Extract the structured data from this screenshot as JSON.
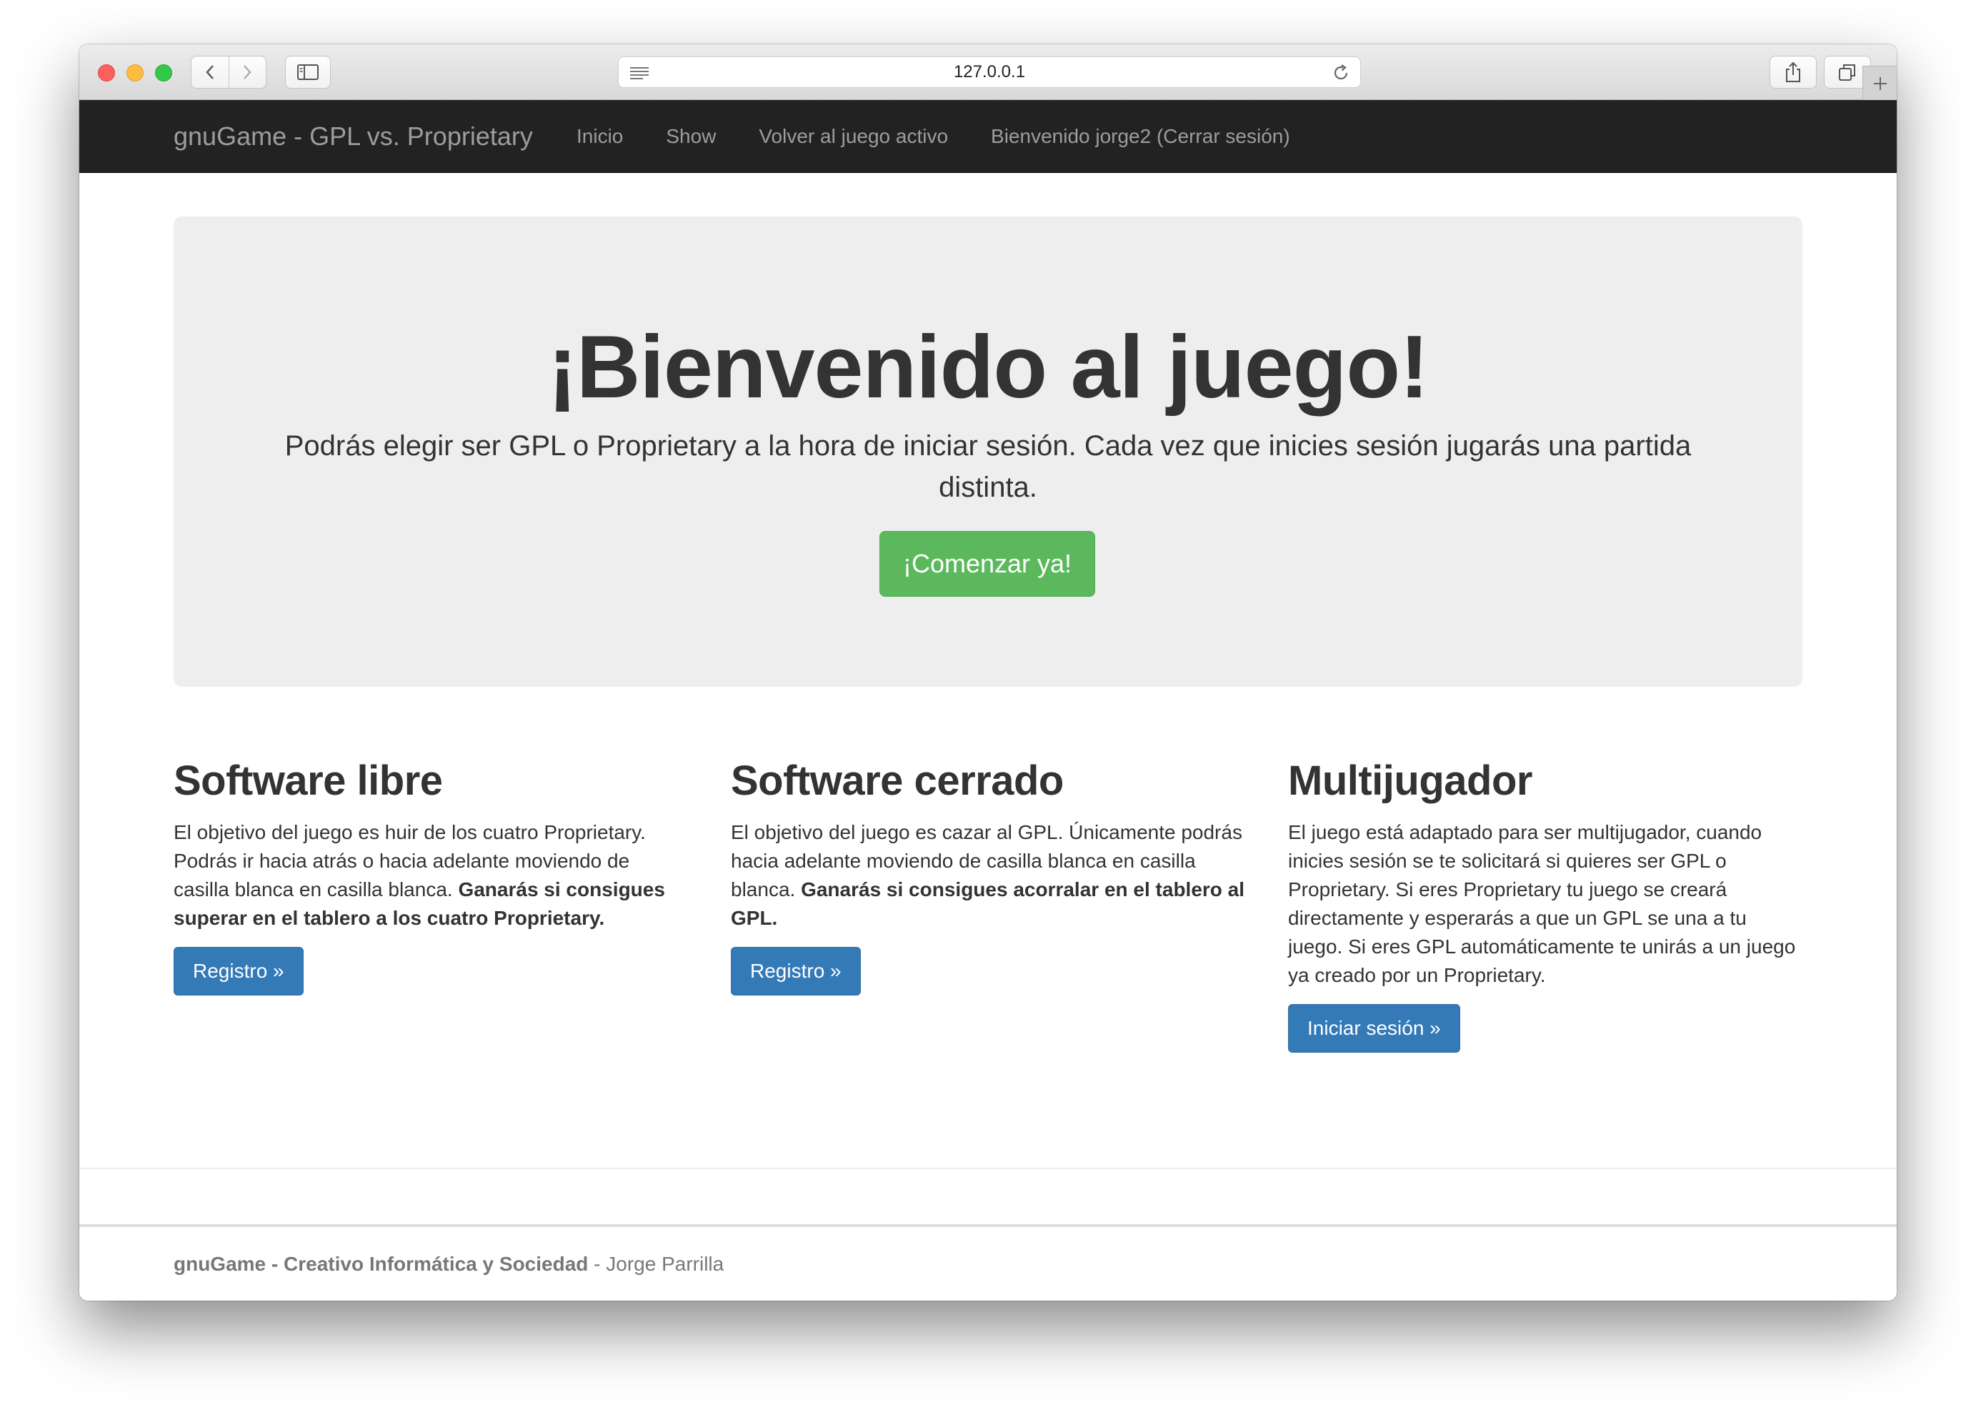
{
  "browser": {
    "url": "127.0.0.1",
    "icons": {
      "back": "chevron-left-icon",
      "forward": "chevron-right-icon",
      "sidebar": "sidebar-icon",
      "reader": "reader-icon",
      "reload": "reload-icon",
      "share": "share-icon",
      "tabs": "tabs-overview-icon",
      "new_tab": "plus-icon"
    }
  },
  "navbar": {
    "brand": "gnuGame - GPL vs. Proprietary",
    "links": [
      "Inicio",
      "Show",
      "Volver al juego activo",
      "Bienvenido jorge2 (Cerrar sesión)"
    ]
  },
  "jumbotron": {
    "title": "¡Bienvenido al juego!",
    "text": "Podrás elegir ser GPL o Proprietary a la hora de iniciar sesión. Cada vez que inicies sesión jugarás una partida distinta.",
    "button": "¡Comenzar ya!"
  },
  "columns": [
    {
      "title": "Software libre",
      "text": "El objetivo del juego es huir de los cuatro Proprietary. Podrás ir hacia atrás o hacia adelante moviendo de casilla blanca en casilla blanca. ",
      "bold": "Ganarás si consigues superar en el tablero a los cuatro Proprietary.",
      "button": "Registro »"
    },
    {
      "title": "Software cerrado",
      "text": "El objetivo del juego es cazar al GPL. Únicamente podrás hacia adelante moviendo de casilla blanca en casilla blanca. ",
      "bold": "Ganarás si consigues acorralar en el tablero al GPL.",
      "button": "Registro »"
    },
    {
      "title": "Multijugador",
      "text": "El juego está adaptado para ser multijugador, cuando inicies sesión se te solicitará si quieres ser GPL o Proprietary. Si eres Proprietary tu juego se creará directamente y esperarás a que un GPL se una a tu juego. Si eres GPL automáticamente te unirás a un juego ya creado por un Proprietary.",
      "bold": "",
      "button": "Iniciar sesión »"
    }
  ],
  "footer": {
    "bold": "gnuGame - Creativo Informática y Sociedad",
    "rest": " - Jorge Parrilla"
  },
  "colors": {
    "navbar_bg": "#222222",
    "jumbotron_bg": "#eeeeee",
    "success": "#5cb85c",
    "primary": "#337ab7"
  }
}
